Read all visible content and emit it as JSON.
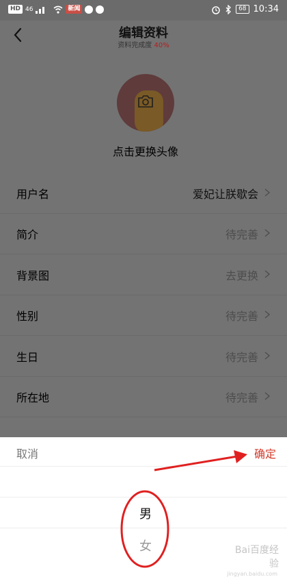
{
  "status_bar": {
    "left_chips": [
      "HD",
      "46",
      "新闻"
    ],
    "time": "10:34",
    "battery": "68"
  },
  "header": {
    "title": "编辑资料",
    "completion_label": "资料完成度",
    "completion_value": "40%"
  },
  "avatar": {
    "change_label": "点击更换头像"
  },
  "profile_rows": [
    {
      "label": "用户名",
      "value": "爱妃让朕歇会"
    },
    {
      "label": "简介",
      "value": "待完善"
    },
    {
      "label": "背景图",
      "value": "去更换"
    },
    {
      "label": "性别",
      "value": "待完善"
    },
    {
      "label": "生日",
      "value": "待完善"
    },
    {
      "label": "所在地",
      "value": "待完善"
    }
  ],
  "picker": {
    "cancel_label": "取消",
    "confirm_label": "确定",
    "options": [
      "男",
      "女"
    ],
    "selected": "男"
  },
  "watermark": {
    "text": "Bai百度经验",
    "url": "jingyan.baidu.com"
  },
  "colors": {
    "accent": "#d13c2c",
    "overlay": "#737373",
    "annotation": "#e02020"
  }
}
